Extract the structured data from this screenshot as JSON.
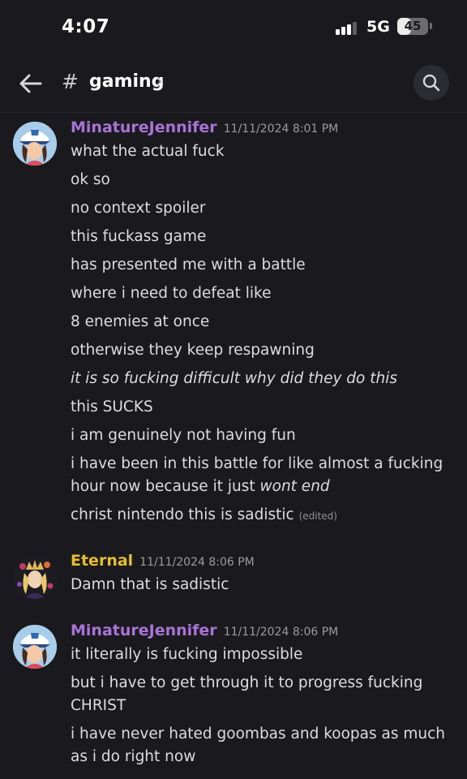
{
  "status_bar": {
    "time": "4:07",
    "network": "5G",
    "battery": "45",
    "battery_level": 0.45
  },
  "header": {
    "channel_hash": "#",
    "channel_name": "gaming",
    "chevron": "›"
  },
  "icons": {
    "back": "back-arrow-icon",
    "search": "search-icon",
    "channel": "hash-icon"
  },
  "colors": {
    "background": "#1a1a1e",
    "author_purple": "#a973d6",
    "author_gold": "#e6be2e",
    "text": "#dcdde0",
    "timestamp": "#9a9ba0"
  },
  "messages": [
    {
      "author": "MinatureJennifer",
      "timestamp": "11/11/2024 8:01 PM",
      "lines": [
        {
          "text": "what the actual fuck"
        },
        {
          "text": "ok so"
        },
        {
          "text": "no context spoiler"
        },
        {
          "text": "this fuckass game"
        },
        {
          "text": "has presented me with a battle"
        },
        {
          "text": "where i need to defeat like"
        },
        {
          "text": "8 enemies at once"
        },
        {
          "text": "otherwise they keep respawning"
        },
        {
          "text": "it is so fucking difficult why did they do this"
        },
        {
          "text": "this SUCKS"
        },
        {
          "text": "i am genuinely not having fun"
        },
        {
          "text": "i have been in this battle for like almost a fucking hour now because it just",
          "italic_tail": "wont end"
        },
        {
          "text": "christ nintendo this is sadistic",
          "edited": "(edited)"
        }
      ]
    },
    {
      "author": "Eternal",
      "timestamp": "11/11/2024 8:06 PM",
      "lines": [
        {
          "text": "Damn that is sadistic"
        }
      ]
    },
    {
      "author": "MinatureJennifer",
      "timestamp": "11/11/2024 8:06 PM",
      "lines": [
        {
          "text": "it literally is fucking impossible"
        },
        {
          "text": "but i have to get through it to progress fucking CHRIST"
        },
        {
          "text": "i have never hated goombas and koopas as much as i do right now"
        }
      ]
    }
  ]
}
